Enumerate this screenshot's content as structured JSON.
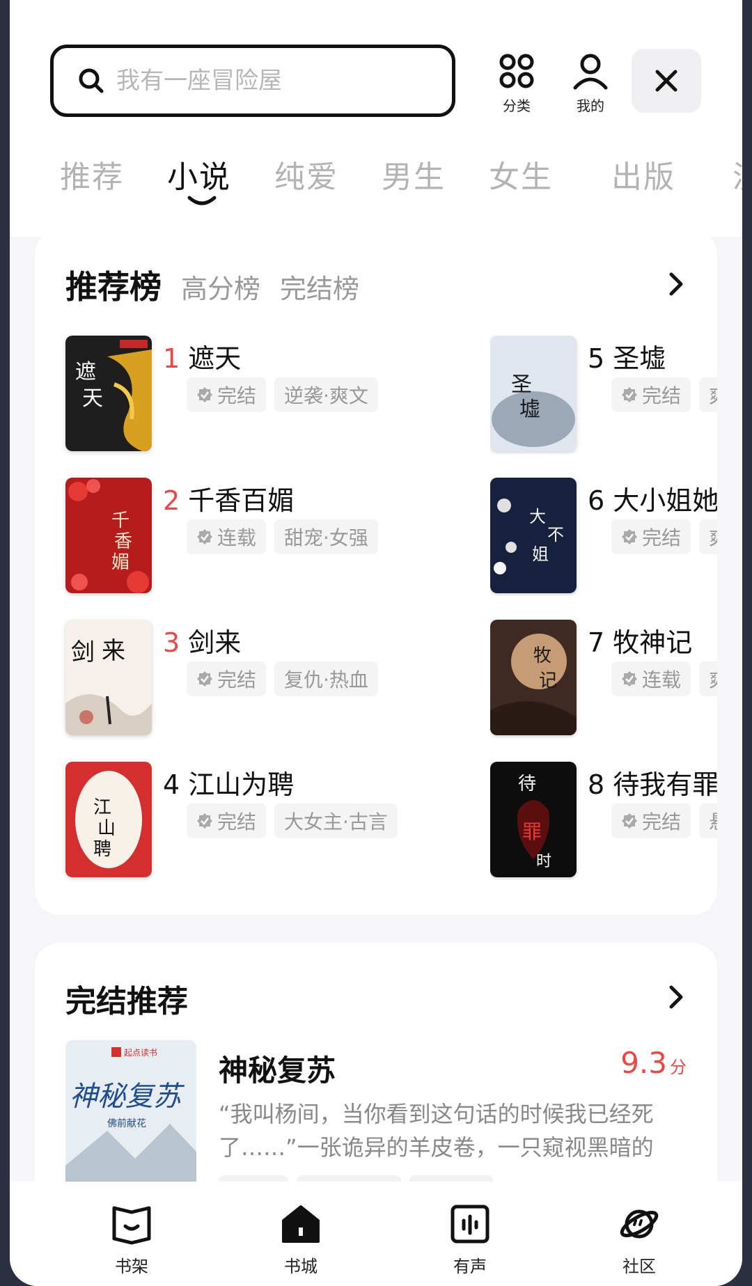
{
  "search": {
    "placeholder": "我有一座冒险屋"
  },
  "header_buttons": {
    "category": "分类",
    "mine": "我的"
  },
  "tabs": [
    {
      "label": "推荐",
      "active": false
    },
    {
      "label": "小说",
      "active": true
    },
    {
      "label": "纯爱",
      "active": false
    },
    {
      "label": "男生",
      "active": false
    },
    {
      "label": "女生",
      "active": false
    },
    {
      "label": "出版",
      "active": false
    },
    {
      "label": "漫",
      "active": false
    }
  ],
  "rankings": {
    "tabs": [
      "推荐榜",
      "高分榜",
      "完结榜"
    ],
    "books": [
      {
        "rank": "1",
        "title": "遮天",
        "status": "完结",
        "genre": "逆袭·爽文"
      },
      {
        "rank": "2",
        "title": "千香百媚",
        "status": "连载",
        "genre": "甜宠·女强"
      },
      {
        "rank": "3",
        "title": "剑来",
        "status": "完结",
        "genre": "复仇·热血"
      },
      {
        "rank": "4",
        "title": "江山为聘",
        "status": "完结",
        "genre": "大女主·古言"
      },
      {
        "rank": "5",
        "title": "圣墟",
        "status": "完结",
        "genre": "爽"
      },
      {
        "rank": "6",
        "title": "大小姐她从",
        "status": "完结",
        "genre": "爽"
      },
      {
        "rank": "7",
        "title": "牧神记",
        "status": "连载",
        "genre": "爽"
      },
      {
        "rank": "8",
        "title": "待我有罪时",
        "status": "完结",
        "genre": "悬"
      }
    ]
  },
  "finished": {
    "section_title": "完结推荐",
    "book_title": "神秘复苏",
    "score": "9.3",
    "score_unit": "分",
    "description": "“我叫杨间，当你看到这句话的时候我已经死了……”一张诡异的羊皮卷，一只窥视黑暗的",
    "cover_brand": "起点读书",
    "cover_author": "佛前献花"
  },
  "bottom_nav": [
    "书架",
    "书城",
    "有声",
    "社区"
  ],
  "colors": {
    "accent": "#ee4646",
    "text": "#111111",
    "muted": "#999999"
  }
}
